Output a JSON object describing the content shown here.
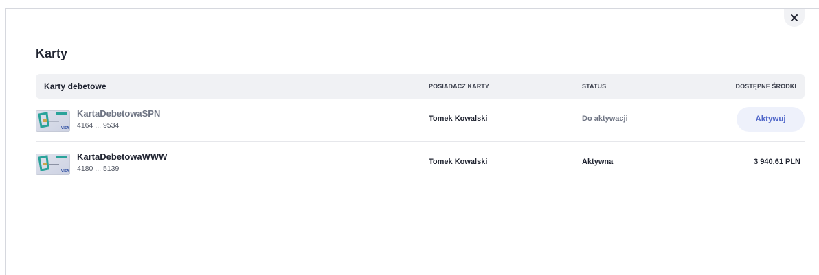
{
  "modal": {
    "title": "Karty",
    "close_icon": "close-icon"
  },
  "table": {
    "headers": {
      "card_group": "Karty debetowe",
      "owner": "POSIADACZ KARTY",
      "status": "STATUS",
      "funds": "DOSTĘPNE ŚRODKI"
    },
    "rows": [
      {
        "name": "KartaDebetowaSPN",
        "number": "4164 ... 9534",
        "owner": "Tomek Kowalski",
        "status": "Do aktywacji",
        "action_label": "Aktywuj",
        "amount": null
      },
      {
        "name": "KartaDebetowaWWW",
        "number": "4180 ... 5139",
        "owner": "Tomek Kowalski",
        "status": "Aktywna",
        "action_label": null,
        "amount": "3 940,61 PLN"
      }
    ]
  },
  "colors": {
    "inactive_text": "#6e7483",
    "active_text": "#1f2330",
    "accent": "#4f66c9",
    "card_green": "#2aa39a"
  }
}
